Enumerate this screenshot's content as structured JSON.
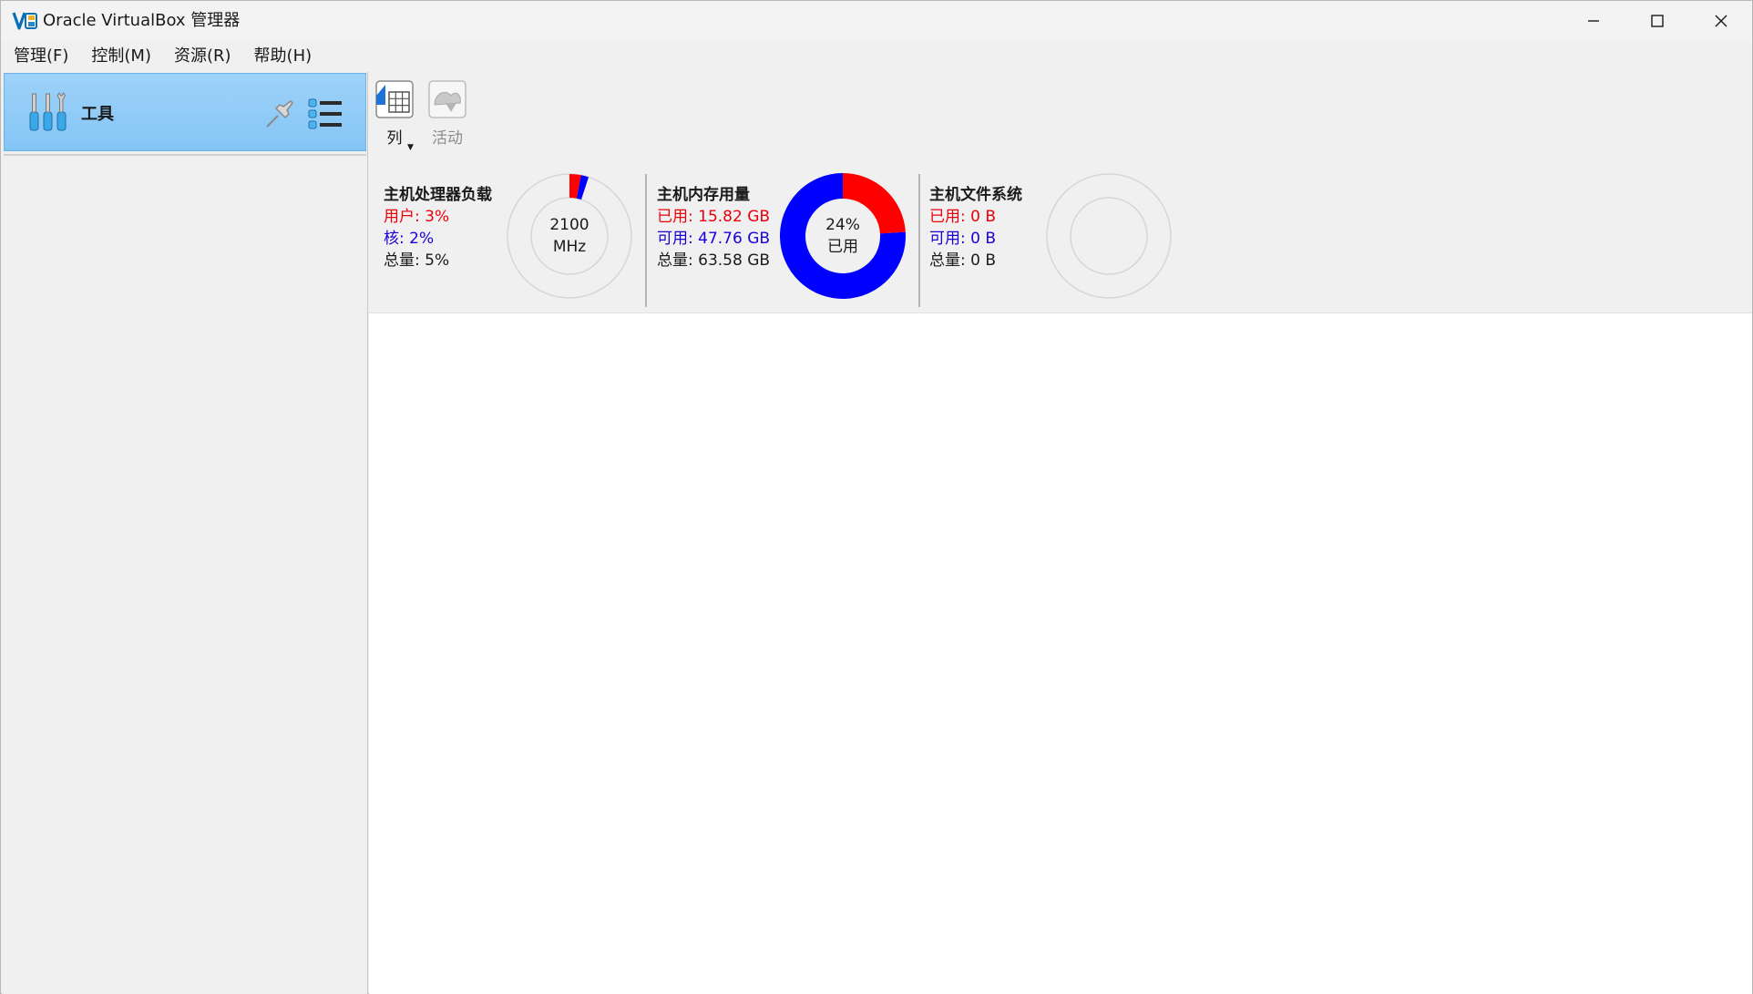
{
  "window": {
    "title": "Oracle VirtualBox 管理器"
  },
  "menu": {
    "items": [
      "管理(F)",
      "控制(M)",
      "资源(R)",
      "帮助(H)"
    ]
  },
  "sidebar": {
    "tools_label": "工具"
  },
  "toolbar": {
    "columns_label": "列",
    "activity_label": "活动"
  },
  "monitor": {
    "cpu": {
      "title": "主机处理器负载",
      "user": "用户: 3%",
      "kernel": "核: 2%",
      "total": "总量: 5%",
      "center_line1": "2100",
      "center_line2": "MHz",
      "user_pct": 3,
      "kernel_pct": 2
    },
    "memory": {
      "title": "主机内存用量",
      "used": "已用: 15.82 GB",
      "free": "可用: 47.76 GB",
      "total": "总量: 63.58 GB",
      "center_line1": "24%",
      "center_line2": "已用",
      "used_pct": 24
    },
    "filesystem": {
      "title": "主机文件系统",
      "used": "已用: 0 B",
      "free": "可用: 0 B",
      "total": "总量: 0 B"
    }
  },
  "colors": {
    "used": "#ff0000",
    "free": "#0000ff",
    "selection": "#90ccf7"
  },
  "icons": [
    "virtualbox-logo-icon",
    "minimize-icon",
    "maximize-icon",
    "close-icon",
    "tools-icon",
    "pin-icon",
    "list-view-icon",
    "columns-icon",
    "activity-icon"
  ]
}
